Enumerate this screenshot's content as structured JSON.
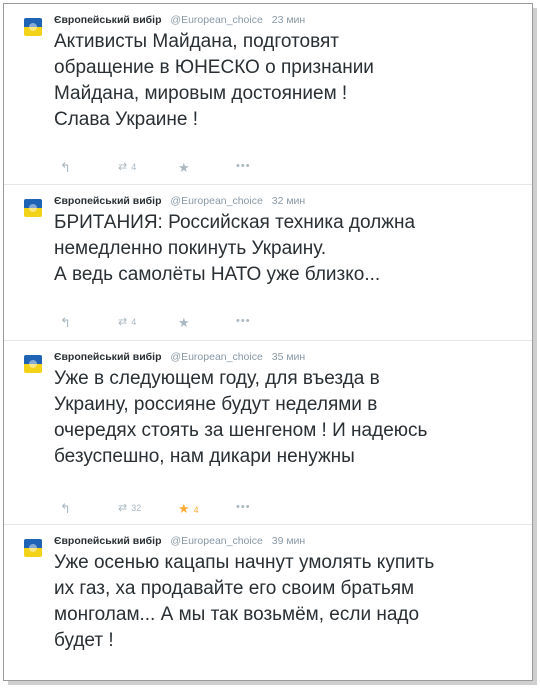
{
  "tweets": [
    {
      "name": "Європейський вибір",
      "handle": "@European_choice",
      "time": "23 мин",
      "text": "Активисты Майдана, подготовят\nобращение в ЮНЕСКО о признании\nМайдана, мировым достоянием !\nСлава Украине !",
      "reply_icon": "↰",
      "retweet_icon": "⇄",
      "retweet_count": "4",
      "favorite_icon": "★",
      "favorite_count": "",
      "favorite_active": false,
      "more_icon": "•••"
    },
    {
      "name": "Європейський вибір",
      "handle": "@European_choice",
      "time": "32 мин",
      "text": "БРИТАНИЯ: Российская техника должна\nнемедленно покинуть Украину.\nА ведь самолёты НАТО уже близко...",
      "reply_icon": "↰",
      "retweet_icon": "⇄",
      "retweet_count": "4",
      "favorite_icon": "★",
      "favorite_count": "",
      "favorite_active": false,
      "more_icon": "•••"
    },
    {
      "name": "Європейський вибір",
      "handle": "@European_choice",
      "time": "35 мин",
      "text": "Уже в следующем году, для въезда в\nУкраину, россияне будут неделями в\nочередях стоять за шенгеном ! И надеюсь\nбезуспешно, нам дикари ненужны",
      "reply_icon": "↰",
      "retweet_icon": "⇄",
      "retweet_count": "32",
      "favorite_icon": "★",
      "favorite_count": "4",
      "favorite_active": true,
      "more_icon": "•••"
    },
    {
      "name": "Європейський вибір",
      "handle": "@European_choice",
      "time": "39 мин",
      "text": "Уже осенью кацапы начнут умолять купить\nих газ, ха продавайте его своим братьям\nмонголам... А мы так возьмём, если надо\nбудет !",
      "reply_icon": "",
      "retweet_icon": "",
      "retweet_count": "",
      "favorite_icon": "",
      "favorite_count": "",
      "favorite_active": false,
      "more_icon": ""
    }
  ],
  "colors": {
    "name": "#292f33",
    "meta": "#8899a6",
    "action": "#aab8c2",
    "favorite_active": "#ffac33"
  }
}
